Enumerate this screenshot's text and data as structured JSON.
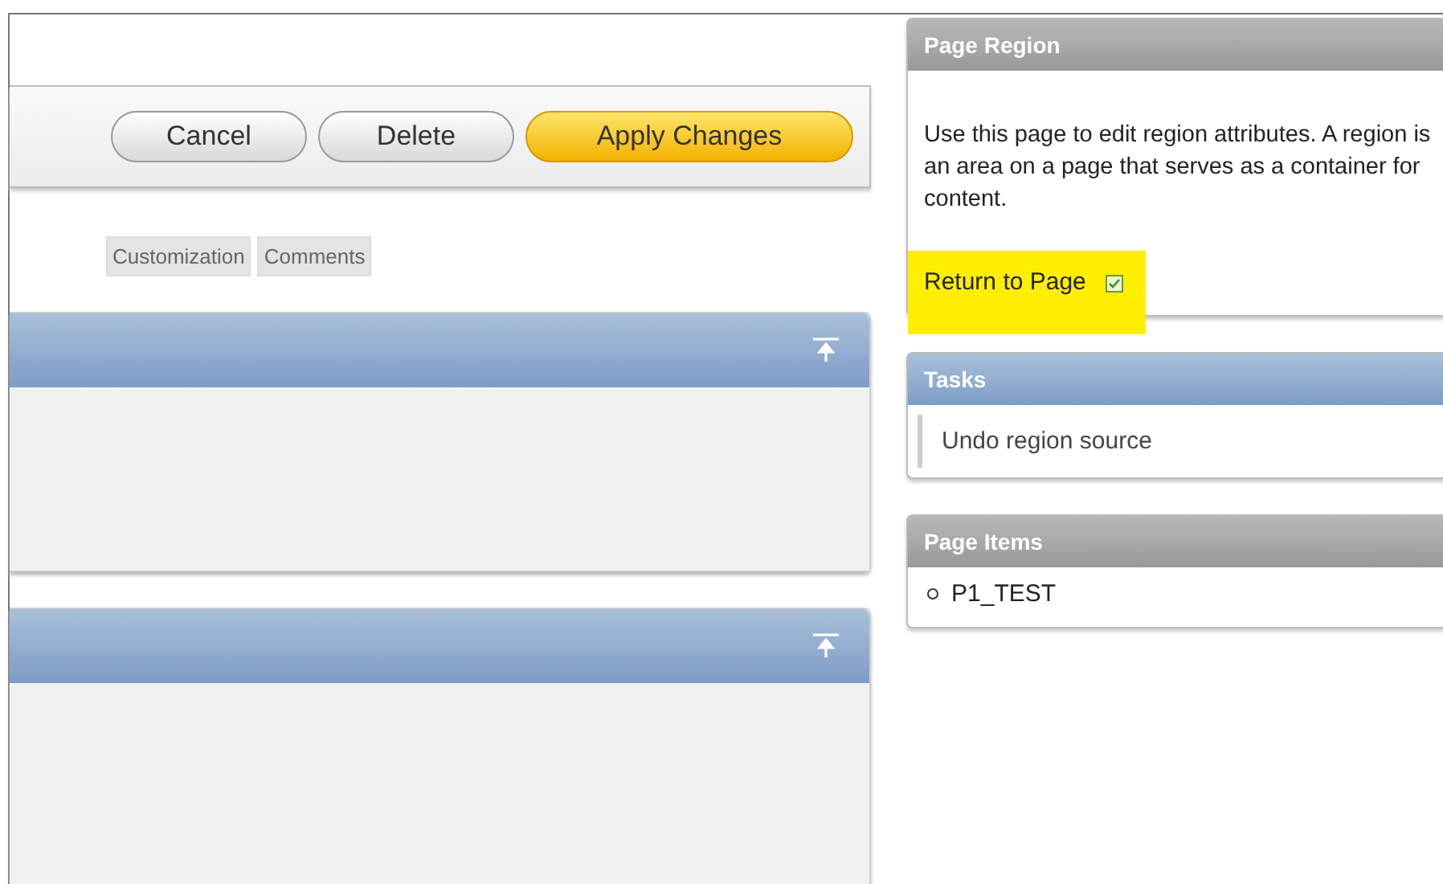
{
  "buttons": [
    {
      "label": "Cancel",
      "kind": "plain"
    },
    {
      "label": "Delete",
      "kind": "plain"
    },
    {
      "label": "Apply Changes",
      "kind": "primary"
    }
  ],
  "tabs": [
    {
      "label": "Customization"
    },
    {
      "label": "Comments"
    }
  ],
  "regions": [
    {
      "kind": "region"
    },
    {
      "kind": "region"
    }
  ],
  "page_region": {
    "title": "Page Region",
    "text": "Use this page to edit region attributes. A region is an area on a page that serves as a container for content.",
    "return_link": "Return to Page",
    "return_highlighted": true
  },
  "tasks": {
    "title": "Tasks",
    "items": [
      "Undo region source"
    ]
  },
  "page_items": {
    "title": "Page Items",
    "items": [
      "P1_TEST"
    ]
  }
}
